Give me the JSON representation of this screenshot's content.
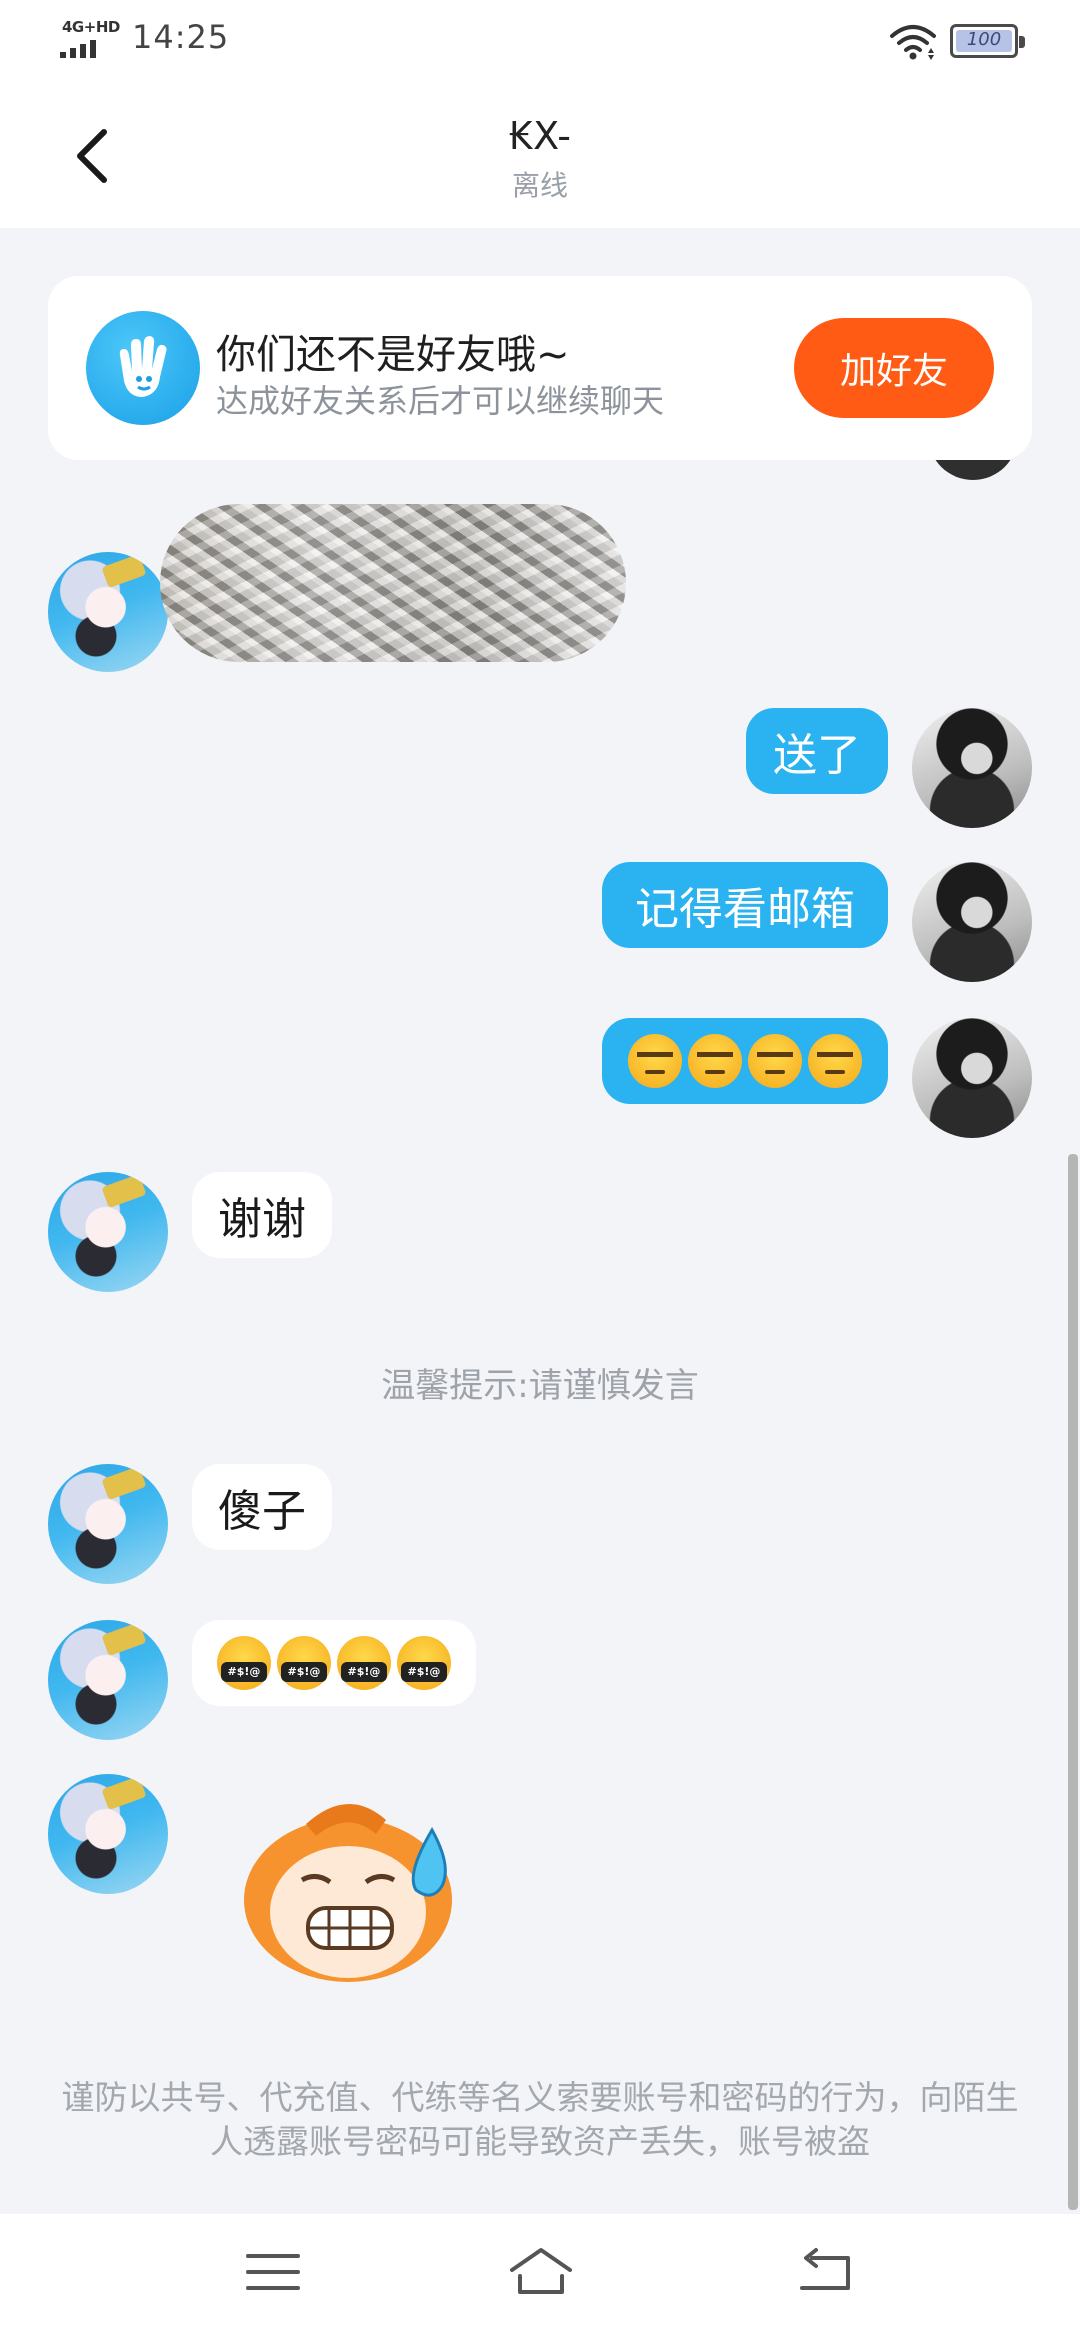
{
  "status_bar": {
    "network": "4G+HD",
    "time": "14:25",
    "battery": "100"
  },
  "header": {
    "title": "₭X-",
    "subtitle": "离线"
  },
  "friend_banner": {
    "title": "你们还不是好友哦~",
    "subtitle": "达成好友关系后才可以继续聊天",
    "button_label": "加好友"
  },
  "messages": [
    {
      "from": "them",
      "type": "image"
    },
    {
      "from": "me",
      "type": "text",
      "text": "送了"
    },
    {
      "from": "me",
      "type": "text",
      "text": "记得看邮箱"
    },
    {
      "from": "me",
      "type": "emoji",
      "emoji": "unamused-face",
      "count": 4
    },
    {
      "from": "them",
      "type": "text",
      "text": "谢谢"
    },
    {
      "from": "system",
      "type": "tip",
      "text": "温馨提示:请谨慎发言"
    },
    {
      "from": "them",
      "type": "text",
      "text": "傻子"
    },
    {
      "from": "them",
      "type": "emoji",
      "emoji": "cursing-face",
      "count": 4
    },
    {
      "from": "them",
      "type": "sticker"
    }
  ],
  "footer_warning": "谨防以共号、代充值、代练等名义索要账号和密码的行为，向陌生人透露账号密码可能导致资产丢失，账号被盗",
  "icons": {
    "back": "chevron-left-icon",
    "friend": "hand-wave-icon",
    "menu": "menu-icon",
    "home": "home-icon",
    "return": "return-icon"
  },
  "colors": {
    "accent_blue": "#2ab3f0",
    "add_friend_orange": "#ff5b14",
    "background": "#f3f4f8"
  }
}
